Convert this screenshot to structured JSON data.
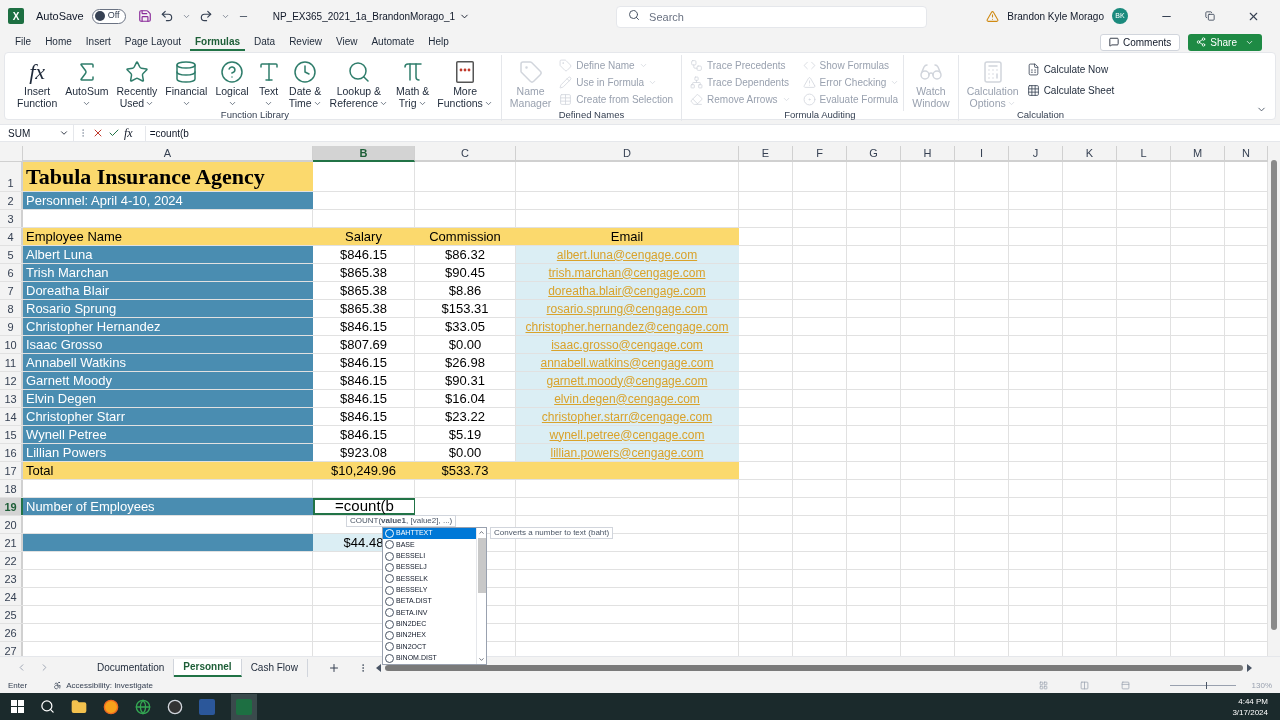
{
  "title_bar": {
    "app_letter": "X",
    "autosave_label": "AutoSave",
    "autosave": {
      "label": "Off",
      "on": false
    },
    "file_name": "NP_EX365_2021_1a_BrandonMorago_1",
    "search_placeholder": "Search",
    "user_name": "Brandon Kyle Morago",
    "user_initials": "BK"
  },
  "menu_tabs": [
    {
      "label": "File",
      "selected": false
    },
    {
      "label": "Home",
      "selected": false
    },
    {
      "label": "Insert",
      "selected": false
    },
    {
      "label": "Page Layout",
      "selected": false
    },
    {
      "label": "Formulas",
      "selected": true
    },
    {
      "label": "Data",
      "selected": false
    },
    {
      "label": "Review",
      "selected": false
    },
    {
      "label": "View",
      "selected": false
    },
    {
      "label": "Automate",
      "selected": false
    },
    {
      "label": "Help",
      "selected": false
    }
  ],
  "share_buttons": {
    "comments": "Comments",
    "share": "Share"
  },
  "ribbon_groups": [
    {
      "title": "Function Library",
      "large": [
        {
          "kind": "fx",
          "glyph": "fx",
          "lines": [
            "Insert",
            "Function"
          ],
          "dropdown": false,
          "disabled": false
        },
        {
          "kind": "sigma",
          "lines": [
            "AutoSum"
          ],
          "dropdown": true,
          "disabled": false
        },
        {
          "kind": "star",
          "lines": [
            "Recently",
            "Used"
          ],
          "dropdown": true,
          "disabled": false
        },
        {
          "kind": "database",
          "lines": [
            "Financial"
          ],
          "dropdown": true,
          "disabled": false
        },
        {
          "kind": "question",
          "lines": [
            "Logical"
          ],
          "dropdown": true,
          "disabled": false
        },
        {
          "kind": "type",
          "lines": [
            "Text"
          ],
          "dropdown": true,
          "disabled": false
        },
        {
          "kind": "clock",
          "lines": [
            "Date &",
            "Time"
          ],
          "dropdown": true,
          "disabled": false
        },
        {
          "kind": "search",
          "lines": [
            "Lookup &",
            "Reference"
          ],
          "dropdown": true,
          "disabled": false
        },
        {
          "kind": "pi",
          "lines": [
            "Math &",
            "Trig"
          ],
          "dropdown": true,
          "disabled": false
        },
        {
          "kind": "dots",
          "lines": [
            "More",
            "Functions"
          ],
          "dropdown": true,
          "disabled": false
        }
      ]
    },
    {
      "title": "Defined Names",
      "large": [
        {
          "kind": "tag",
          "lines": [
            "Name",
            "Manager"
          ],
          "dropdown": false,
          "disabled": true
        }
      ],
      "small": [
        {
          "kind": "tag",
          "label": "Define Name",
          "dropdown": true,
          "disabled": true
        },
        {
          "kind": "pencil",
          "label": "Use in Formula",
          "dropdown": true,
          "disabled": true
        },
        {
          "kind": "table",
          "label": "Create from Selection",
          "dropdown": false,
          "disabled": true
        }
      ]
    },
    {
      "title": "Formula Auditing",
      "small": [
        {
          "kind": "workflow",
          "label": "Trace Precedents",
          "dropdown": false,
          "disabled": true
        },
        {
          "kind": "network",
          "label": "Trace Dependents",
          "dropdown": false,
          "disabled": true
        },
        {
          "kind": "eraser",
          "label": "Remove Arrows",
          "dropdown": true,
          "disabled": true
        },
        {
          "kind": "code",
          "label": "Show Formulas",
          "dropdown": false,
          "disabled": true
        },
        {
          "kind": "warning",
          "label": "Error Checking",
          "dropdown": true,
          "disabled": true
        },
        {
          "kind": "target",
          "label": "Evaluate Formula",
          "dropdown": false,
          "disabled": true
        }
      ],
      "large_after": [
        {
          "kind": "glasses",
          "lines": [
            "Watch",
            "Window"
          ],
          "dropdown": false,
          "disabled": true
        }
      ]
    },
    {
      "title": "Calculation",
      "large": [
        {
          "kind": "calculator",
          "lines": [
            "Calculation",
            "Options"
          ],
          "dropdown": true,
          "disabled": true
        }
      ],
      "small": [
        {
          "kind": "sheet",
          "label": "Calculate Now",
          "dropdown": false,
          "disabled": false
        },
        {
          "kind": "grid",
          "label": "Calculate Sheet",
          "dropdown": false,
          "disabled": false
        }
      ]
    }
  ],
  "formula_bar": {
    "name_box": "SUM",
    "fx": "fx",
    "value": "=count(b"
  },
  "columns": [
    {
      "label": "A",
      "selected": false
    },
    {
      "label": "B",
      "selected": true
    },
    {
      "label": "C",
      "selected": false
    },
    {
      "label": "D",
      "selected": false
    },
    {
      "label": "E",
      "selected": false
    },
    {
      "label": "F",
      "selected": false
    },
    {
      "label": "G",
      "selected": false
    },
    {
      "label": "H",
      "selected": false
    },
    {
      "label": "I",
      "selected": false
    },
    {
      "label": "J",
      "selected": false
    },
    {
      "label": "K",
      "selected": false
    },
    {
      "label": "L",
      "selected": false
    },
    {
      "label": "M",
      "selected": false
    },
    {
      "label": "N",
      "selected": false
    }
  ],
  "rows": [
    {
      "number": "1",
      "selected": false,
      "cells": [
        {
          "kind": "title",
          "text": "Tabula Insurance Agency"
        }
      ]
    },
    {
      "number": "2",
      "selected": false,
      "cells": [
        {
          "kind": "band",
          "text": "Personnel: April 4-10, 2024"
        }
      ]
    },
    {
      "number": "3",
      "selected": false
    },
    {
      "number": "4",
      "selected": false,
      "cells": [
        {
          "kind": "header",
          "text": "Employee Name"
        },
        {
          "kind": "header",
          "text": "Salary"
        },
        {
          "kind": "header",
          "text": "Commission"
        },
        {
          "kind": "header",
          "text": "Email"
        }
      ]
    },
    {
      "number": "5",
      "selected": false,
      "cells": [
        {
          "kind": "band",
          "text": "Albert Luna"
        },
        {
          "kind": "plain",
          "text": "$846.15"
        },
        {
          "kind": "plain",
          "text": "$86.32"
        },
        {
          "kind": "email",
          "text": "albert.luna@cengage.com"
        }
      ]
    },
    {
      "number": "6",
      "selected": false,
      "cells": [
        {
          "kind": "band",
          "text": "Trish Marchan"
        },
        {
          "kind": "plain",
          "text": "$865.38"
        },
        {
          "kind": "plain",
          "text": "$90.45"
        },
        {
          "kind": "email",
          "text": "trish.marchan@cengage.com"
        }
      ]
    },
    {
      "number": "7",
      "selected": false,
      "cells": [
        {
          "kind": "band",
          "text": "Doreatha Blair"
        },
        {
          "kind": "plain",
          "text": "$865.38"
        },
        {
          "kind": "plain",
          "text": "$8.86"
        },
        {
          "kind": "email",
          "text": "doreatha.blair@cengage.com"
        }
      ]
    },
    {
      "number": "8",
      "selected": false,
      "cells": [
        {
          "kind": "band",
          "text": "Rosario Sprung"
        },
        {
          "kind": "plain",
          "text": "$865.38"
        },
        {
          "kind": "plain",
          "text": "$153.31"
        },
        {
          "kind": "email",
          "text": "rosario.sprung@cengage.com"
        }
      ]
    },
    {
      "number": "9",
      "selected": false,
      "cells": [
        {
          "kind": "band",
          "text": "Christopher Hernandez"
        },
        {
          "kind": "plain",
          "text": "$846.15"
        },
        {
          "kind": "plain",
          "text": "$33.05"
        },
        {
          "kind": "email",
          "text": "christopher.hernandez@cengage.com"
        }
      ]
    },
    {
      "number": "10",
      "selected": false,
      "cells": [
        {
          "kind": "band",
          "text": "Isaac Grosso"
        },
        {
          "kind": "plain",
          "text": "$807.69"
        },
        {
          "kind": "plain",
          "text": "$0.00"
        },
        {
          "kind": "email",
          "text": "isaac.grosso@cengage.com"
        }
      ]
    },
    {
      "number": "11",
      "selected": false,
      "cells": [
        {
          "kind": "band",
          "text": "Annabell Watkins"
        },
        {
          "kind": "plain",
          "text": "$846.15"
        },
        {
          "kind": "plain",
          "text": "$26.98"
        },
        {
          "kind": "email",
          "text": "annabell.watkins@cengage.com"
        }
      ]
    },
    {
      "number": "12",
      "selected": false,
      "cells": [
        {
          "kind": "band",
          "text": "Garnett Moody"
        },
        {
          "kind": "plain",
          "text": "$846.15"
        },
        {
          "kind": "plain",
          "text": "$90.31"
        },
        {
          "kind": "email",
          "text": "garnett.moody@cengage.com"
        }
      ]
    },
    {
      "number": "13",
      "selected": false,
      "cells": [
        {
          "kind": "band",
          "text": "Elvin Degen"
        },
        {
          "kind": "plain",
          "text": "$846.15"
        },
        {
          "kind": "plain",
          "text": "$16.04"
        },
        {
          "kind": "email",
          "text": "elvin.degen@cengage.com"
        }
      ]
    },
    {
      "number": "14",
      "selected": false,
      "cells": [
        {
          "kind": "band",
          "text": "Christopher Starr"
        },
        {
          "kind": "plain",
          "text": "$846.15"
        },
        {
          "kind": "plain",
          "text": "$23.22"
        },
        {
          "kind": "email",
          "text": "christopher.starr@cengage.com"
        }
      ]
    },
    {
      "number": "15",
      "selected": false,
      "cells": [
        {
          "kind": "band",
          "text": "Wynell Petree"
        },
        {
          "kind": "plain",
          "text": "$846.15"
        },
        {
          "kind": "plain",
          "text": "$5.19"
        },
        {
          "kind": "email",
          "text": "wynell.petree@cengage.com"
        }
      ]
    },
    {
      "number": "16",
      "selected": false,
      "cells": [
        {
          "kind": "band",
          "text": "Lillian Powers"
        },
        {
          "kind": "plain",
          "text": "$923.08"
        },
        {
          "kind": "plain",
          "text": "$0.00"
        },
        {
          "kind": "email",
          "text": "lillian.powers@cengage.com"
        }
      ]
    },
    {
      "number": "17",
      "selected": false,
      "cells": [
        {
          "kind": "header",
          "text": "Total"
        },
        {
          "kind": "header",
          "text": "$10,249.96"
        },
        {
          "kind": "header",
          "text": "$533.73"
        },
        {
          "kind": "header"
        }
      ]
    },
    {
      "number": "18",
      "selected": false
    },
    {
      "number": "19",
      "selected": true,
      "cells": [
        {
          "kind": "band",
          "text": "Number of Employees"
        },
        {
          "kind": "editing",
          "text": "=count(b"
        }
      ]
    },
    {
      "number": "20",
      "selected": false
    },
    {
      "number": "21",
      "selected": false,
      "cells": [
        {
          "kind": "band"
        },
        {
          "kind": "light",
          "text": "$44.48"
        }
      ]
    },
    {
      "number": "22",
      "selected": false
    },
    {
      "number": "23",
      "selected": false
    },
    {
      "number": "24",
      "selected": false
    },
    {
      "number": "25",
      "selected": false
    },
    {
      "number": "26",
      "selected": false
    },
    {
      "number": "27",
      "selected": false
    }
  ],
  "function_tip": "COUNT(**value1**, [value2], ...)",
  "autocomplete": {
    "items": [
      {
        "label": "BAHTTEXT",
        "selected": true
      },
      {
        "label": "BASE",
        "selected": false
      },
      {
        "label": "BESSELI",
        "selected": false
      },
      {
        "label": "BESSELJ",
        "selected": false
      },
      {
        "label": "BESSELK",
        "selected": false
      },
      {
        "label": "BESSELY",
        "selected": false
      },
      {
        "label": "BETA.DIST",
        "selected": false
      },
      {
        "label": "BETA.INV",
        "selected": false
      },
      {
        "label": "BIN2DEC",
        "selected": false
      },
      {
        "label": "BIN2HEX",
        "selected": false
      },
      {
        "label": "BIN2OCT",
        "selected": false
      },
      {
        "label": "BINOM.DIST",
        "selected": false
      }
    ],
    "description": "Converts a number to text (baht)"
  },
  "sheet_tabs": [
    {
      "label": "Documentation",
      "selected": false
    },
    {
      "label": "Personnel",
      "selected": true
    },
    {
      "label": "Cash Flow",
      "selected": false
    }
  ],
  "status_bar": {
    "mode": "Enter",
    "accessibility": "Accessibility: Investigate",
    "zoom": {
      "label": "130%",
      "level": 0.55
    }
  },
  "taskbar": {
    "time": "4:44 PM",
    "date": "3/17/2024"
  }
}
